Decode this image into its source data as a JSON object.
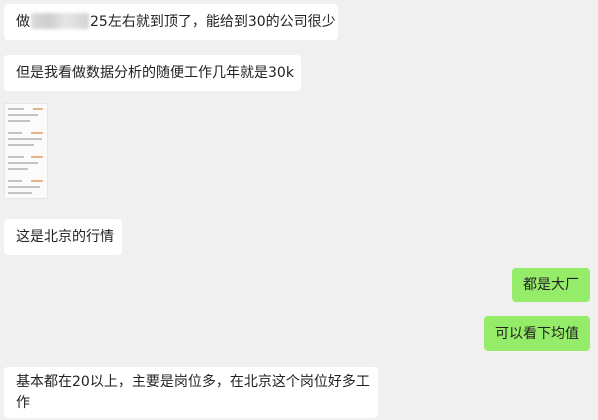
{
  "messages": [
    {
      "side": "left",
      "before": "做",
      "after": "25左右就到顶了，能给到30的公司很少"
    },
    {
      "side": "left",
      "text": "但是我看做数据分析的随便工作几年就是30k"
    },
    {
      "side": "left",
      "image": "screenshot-thumbnail"
    },
    {
      "side": "left",
      "text": "这是北京的行情"
    },
    {
      "side": "right",
      "text": "都是大厂"
    },
    {
      "side": "right",
      "text": "可以看下均值"
    },
    {
      "side": "left",
      "line1": "基本都在20以上，主要是岗位多，在北京这个岗位好多工",
      "line2": "作"
    }
  ],
  "colors": {
    "background": "#f0f0f0",
    "received_bubble": "#ffffff",
    "sent_bubble": "#95ec69"
  }
}
